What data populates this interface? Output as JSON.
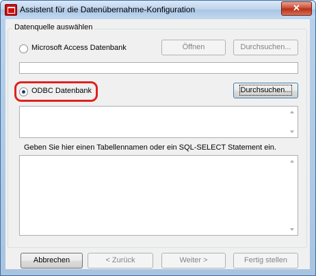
{
  "window": {
    "title": "Assistent für die Datenübernahme-Konfiguration",
    "close_symbol": "✕",
    "icon": "app-icon"
  },
  "source_group": {
    "legend": "Datenquelle auswählen",
    "access_option": {
      "label": "Microsoft Access Datenbank",
      "selected": false
    },
    "open_button": "Öffnen",
    "access_browse_button": "Durchsuchen...",
    "access_path_value": "",
    "odbc_option": {
      "label": "ODBC Datenbank",
      "selected": true
    },
    "odbc_browse_button": "Durchsuchen...",
    "odbc_value": "",
    "sql_instruction": "Geben Sie hier einen Tabellennamen oder ein SQL-SELECT Statement ein.",
    "sql_value": ""
  },
  "footer": {
    "cancel_button": "Abbrechen",
    "back_button": "< Zurück",
    "next_button": "Weiter >",
    "finish_button": "Fertig stellen"
  },
  "colors": {
    "highlight": "#e02020",
    "title_bar": "#bcd3ec"
  }
}
